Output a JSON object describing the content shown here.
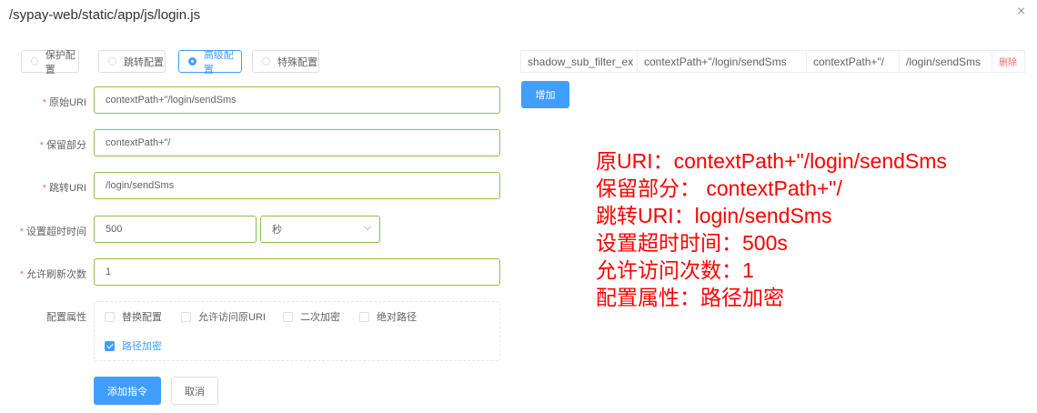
{
  "dialog": {
    "title": "/sypay-web/static/app/js/login.js",
    "close_icon": "×"
  },
  "radios": [
    {
      "label": "保护配置",
      "checked": false
    },
    {
      "label": "跳转配置",
      "checked": false
    },
    {
      "label": "高级配置",
      "checked": true
    },
    {
      "label": "特殊配置",
      "checked": false
    }
  ],
  "form": {
    "original_uri": {
      "label": "原始URI",
      "value": "contextPath+\"/login/sendSms"
    },
    "keep_part": {
      "label": "保留部分",
      "value": "contextPath+\"/"
    },
    "redirect_uri": {
      "label": "跳转URI",
      "value": "/login/sendSms"
    },
    "timeout": {
      "label": "设置超时时间",
      "value": "500",
      "unit": "秒"
    },
    "refresh_count": {
      "label": "允许刷新次数",
      "value": "1"
    },
    "attributes": {
      "label": "配置属性",
      "options": [
        {
          "label": "替换配置",
          "checked": false
        },
        {
          "label": "允许访问原URI",
          "checked": false
        },
        {
          "label": "二次加密",
          "checked": false
        },
        {
          "label": "绝对路径",
          "checked": false
        },
        {
          "label": "路径加密",
          "checked": true
        }
      ]
    },
    "submit_label": "添加指令",
    "cancel_label": "取消"
  },
  "table": {
    "row": [
      "shadow_sub_filter_ex",
      "contextPath+\"/login/sendSms",
      "contextPath+\"/",
      "/login/sendSms"
    ],
    "delete_label": "删除"
  },
  "add_label": "增加",
  "annotations": [
    "原URI：contextPath+\"/login/sendSms",
    "保留部分： contextPath+\"/",
    "跳转URI：login/sendSms",
    "设置超时时间：500s",
    "允许访问次数：1",
    "配置属性：路径加密"
  ],
  "colors": {
    "primary": "#409eff",
    "valid": "#8bc34a",
    "danger": "#f56c6c",
    "annotation": "#ff0000"
  }
}
